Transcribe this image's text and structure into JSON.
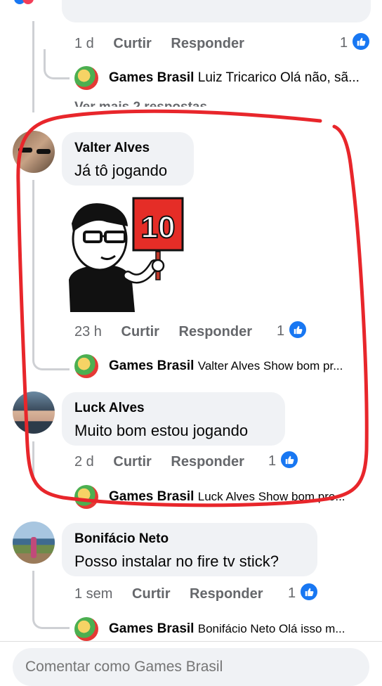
{
  "actions": {
    "like": "Curtir",
    "reply": "Responder"
  },
  "top_comment": {
    "age": "1 d",
    "likes": "1"
  },
  "top_reply": {
    "author": "Games Brasil",
    "text": "Luiz Tricarico  Olá não, sã..."
  },
  "more_replies": "Ver mais 2 respostas",
  "comments": [
    {
      "author": "Valter Alves",
      "text": "Já tô jogando",
      "age": "23 h",
      "likes": "1",
      "sticker_text": "10",
      "reply": {
        "author": "Games Brasil",
        "text": "Valter Alves Show bom pr..."
      }
    },
    {
      "author": "Luck Alves",
      "text": "Muito bom estou jogando",
      "age": "2 d",
      "likes": "1",
      "reply": {
        "author": "Games Brasil",
        "text": "Luck Alves Show bom pro..."
      }
    },
    {
      "author": "Bonifácio Neto",
      "text": "Posso instalar no fire tv stick?",
      "age": "1 sem",
      "likes": "1",
      "reply": {
        "author": "Games Brasil",
        "text": "Bonifácio Neto Olá isso m..."
      }
    }
  ],
  "composer": {
    "placeholder": "Comentar como Games Brasil"
  },
  "colors": {
    "like_blue": "#1877f2",
    "annotation_red": "#e8262b",
    "bubble_bg": "#f0f2f5",
    "muted_text": "#65676b"
  },
  "icons": [
    "like-thumb-icon",
    "sticker-10-sign-icon",
    "games-brasil-avatar-icon"
  ]
}
